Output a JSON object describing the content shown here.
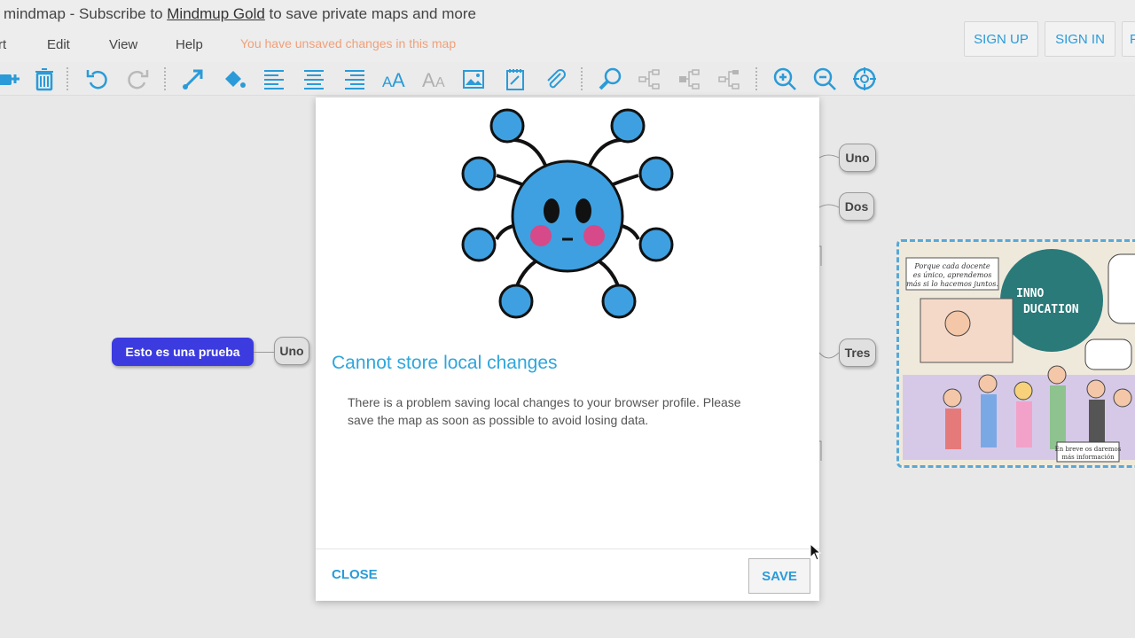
{
  "titlebar": {
    "prefix": "mindmap - Subscribe to ",
    "gold_link": "Mindmup Gold",
    "suffix": " to save private maps and more"
  },
  "menu": {
    "export_partial": "rt",
    "edit": "Edit",
    "view": "View",
    "help": "Help",
    "unsaved_notice": "You have unsaved changes in this map"
  },
  "auth": {
    "sign_up": "SIGN UP",
    "sign_in": "SIGN IN",
    "partial": "F"
  },
  "toolbar": {
    "icons": [
      "add-node-icon",
      "delete-icon",
      "undo-icon",
      "redo-icon",
      "connect-icon",
      "fill-color-icon",
      "align-left-icon",
      "align-center-icon",
      "align-right-icon",
      "font-increase-icon",
      "font-decrease-icon",
      "insert-image-icon",
      "notes-icon",
      "attachment-icon",
      "search-icon",
      "collapse-icon",
      "expand-icon",
      "toggle-icon",
      "zoom-in-icon",
      "zoom-out-icon",
      "reset-zoom-icon"
    ]
  },
  "map": {
    "root": "Esto es una prueba",
    "left_child": "Uno",
    "right_children": [
      "Uno",
      "Dos",
      "Tres"
    ],
    "image_texts": {
      "top_left": "Porque cada docente es único, aprendemos más si lo hacemos juntos.",
      "logo_line1": "INNO",
      "logo_line2": "DUCATION",
      "bottom": "En breve os daremos más información"
    }
  },
  "dialog": {
    "title": "Cannot store local changes",
    "body": "There is a problem saving local changes to your browser profile. Please save the map as soon as possible to avoid losing data.",
    "close_label": "CLOSE",
    "save_label": "SAVE"
  },
  "colors": {
    "accent": "#2ea6dc",
    "root_node": "#3b3be0",
    "unsaved": "#f0a07a"
  }
}
